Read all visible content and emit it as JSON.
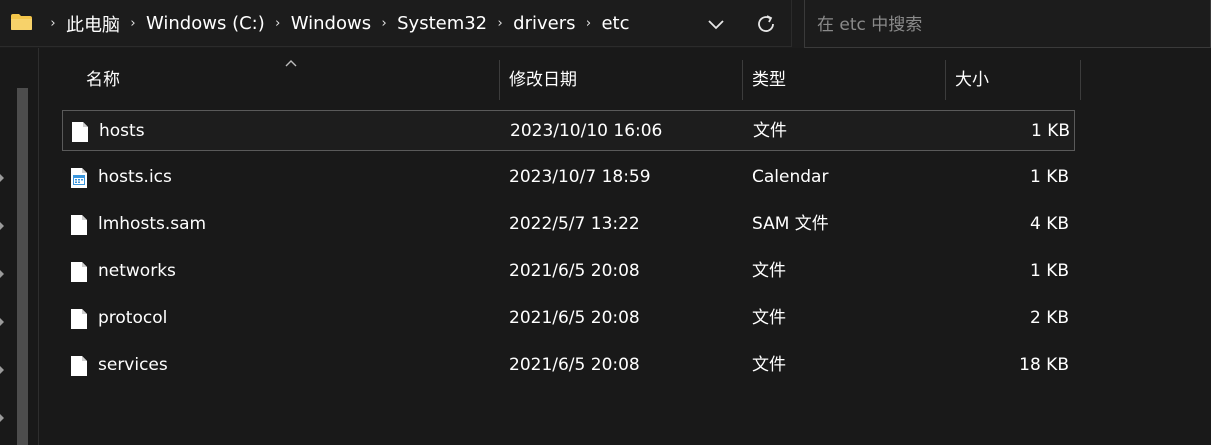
{
  "address_bar": {
    "breadcrumbs": [
      "此电脑",
      "Windows (C:)",
      "Windows",
      "System32",
      "drivers",
      "etc"
    ],
    "separator_icon": "chevron-right-icon",
    "dropdown_icon": "chevron-down-icon",
    "refresh_icon": "refresh-icon"
  },
  "search": {
    "placeholder": "在 etc 中搜索",
    "value": ""
  },
  "columns": {
    "name": "名称",
    "modified": "修改日期",
    "type": "类型",
    "size": "大小",
    "sorted_by": "name"
  },
  "files": [
    {
      "name": "hosts",
      "modified": "2023/10/10 16:06",
      "type": "文件",
      "size": "1 KB",
      "icon": "file-icon",
      "selected": true
    },
    {
      "name": "hosts.ics",
      "modified": "2023/10/7 18:59",
      "type": "Calendar",
      "size": "1 KB",
      "icon": "calendar-file-icon",
      "selected": false
    },
    {
      "name": "lmhosts.sam",
      "modified": "2022/5/7 13:22",
      "type": "SAM 文件",
      "size": "4 KB",
      "icon": "file-icon",
      "selected": false
    },
    {
      "name": "networks",
      "modified": "2021/6/5 20:08",
      "type": "文件",
      "size": "1 KB",
      "icon": "file-icon",
      "selected": false
    },
    {
      "name": "protocol",
      "modified": "2021/6/5 20:08",
      "type": "文件",
      "size": "2 KB",
      "icon": "file-icon",
      "selected": false
    },
    {
      "name": "services",
      "modified": "2021/6/5 20:08",
      "type": "文件",
      "size": "18 KB",
      "icon": "file-icon",
      "selected": false
    }
  ],
  "colors": {
    "background": "#191919",
    "folder": "#f3c54a",
    "calendar_icon": "#3a96dd"
  }
}
